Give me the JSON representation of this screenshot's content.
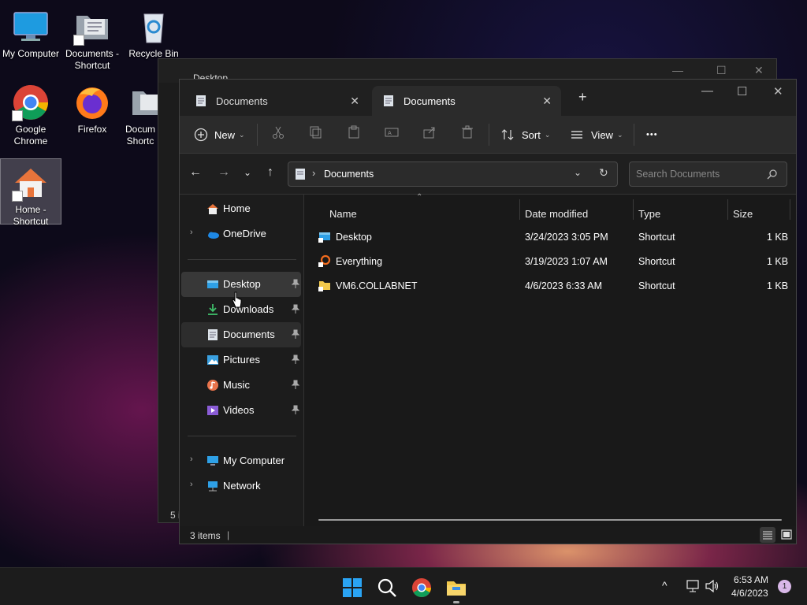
{
  "desktop": {
    "icons": [
      {
        "label": "My Computer",
        "icon": "monitor-icon"
      },
      {
        "label": "Documents - Shortcut",
        "icon": "document-folder-icon"
      },
      {
        "label": "Recycle Bin",
        "icon": "recycle-bin-icon"
      },
      {
        "label": "Google Chrome",
        "icon": "chrome-icon"
      },
      {
        "label": "Firefox",
        "icon": "firefox-icon"
      },
      {
        "label": "Docum Shortc",
        "icon": "document-folder-icon"
      },
      {
        "label": "Home - Shortcut",
        "icon": "home-icon"
      }
    ]
  },
  "back_window": {
    "tab_label": "Desktop",
    "status_fragment": "5 i"
  },
  "window": {
    "tabs": [
      {
        "label": "Documents",
        "active": false
      },
      {
        "label": "Documents",
        "active": true
      }
    ],
    "new_tab_label": "+",
    "controls": {
      "minimize": "—",
      "maximize": "☐",
      "close": "✕"
    }
  },
  "toolbar": {
    "new_label": "New",
    "sort_label": "Sort",
    "view_label": "View",
    "more_label": "•••"
  },
  "address": {
    "separator": "›",
    "current": "Documents",
    "search_placeholder": "Search Documents"
  },
  "nav": {
    "items": [
      {
        "label": "Home",
        "icon": "home-icon"
      },
      {
        "label": "OneDrive",
        "icon": "onedrive-cloud-icon"
      },
      {
        "label": "Desktop",
        "icon": "desktop-folder-icon",
        "pinned": true
      },
      {
        "label": "Downloads",
        "icon": "download-icon",
        "pinned": true
      },
      {
        "label": "Documents",
        "icon": "documents-icon",
        "pinned": true
      },
      {
        "label": "Pictures",
        "icon": "pictures-icon",
        "pinned": true
      },
      {
        "label": "Music",
        "icon": "music-icon",
        "pinned": true
      },
      {
        "label": "Videos",
        "icon": "videos-icon",
        "pinned": true
      },
      {
        "label": "My Computer",
        "icon": "monitor-icon"
      },
      {
        "label": "Network",
        "icon": "network-icon"
      }
    ]
  },
  "columns": {
    "name": "Name",
    "date": "Date modified",
    "type": "Type",
    "size": "Size"
  },
  "files": [
    {
      "name": "Desktop",
      "date": "3/24/2023 3:05 PM",
      "type": "Shortcut",
      "size": "1 KB",
      "icon": "desktop-shortcut-icon"
    },
    {
      "name": "Everything",
      "date": "3/19/2023 1:07 AM",
      "type": "Shortcut",
      "size": "1 KB",
      "icon": "everything-search-icon"
    },
    {
      "name": "VM6.COLLABNET",
      "date": "4/6/2023 6:33 AM",
      "type": "Shortcut",
      "size": "1 KB",
      "icon": "folder-shortcut-icon"
    }
  ],
  "status": {
    "items_text": "3 items",
    "cursor": "|"
  },
  "taskbar": {
    "time": "6:53 AM",
    "date": "4/6/2023",
    "notification_count": "1",
    "chevron": "^"
  },
  "colors": {
    "accent": "#0078d4",
    "window_bg": "#191919",
    "taskbar_bg": "#1c1c1c"
  }
}
